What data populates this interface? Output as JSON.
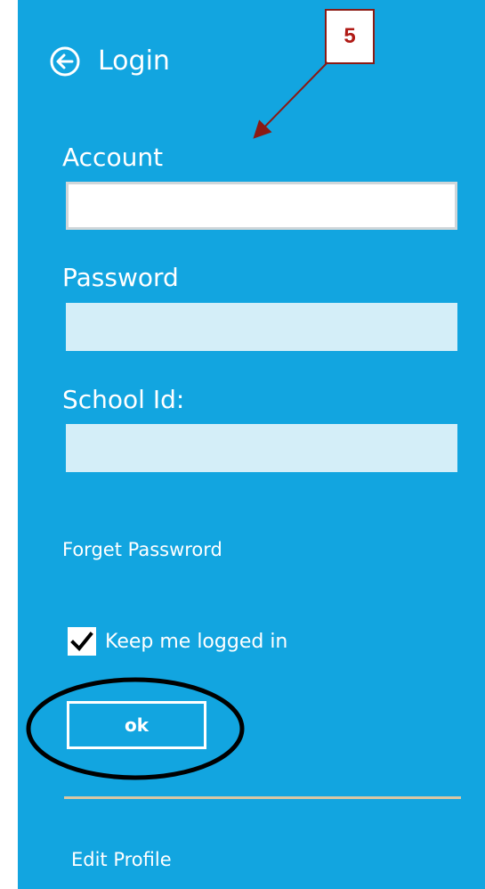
{
  "header": {
    "title": "Login",
    "back_icon": "back-arrow-circle-icon"
  },
  "fields": {
    "account_label": "Account",
    "password_label": "Password",
    "school_label": "School Id:"
  },
  "links": {
    "forgot_password": "Forget Passwrord",
    "edit_profile": "Edit Profile"
  },
  "keep_logged_in": {
    "label": "Keep me logged in",
    "checked": true
  },
  "actions": {
    "ok_label": "ok"
  },
  "annotation": {
    "number": "5"
  },
  "colors": {
    "panel": "#12a5e0",
    "field_inactive": "#d4eef8",
    "annotation": "#8a1a14",
    "divider": "#d8c7a4"
  }
}
